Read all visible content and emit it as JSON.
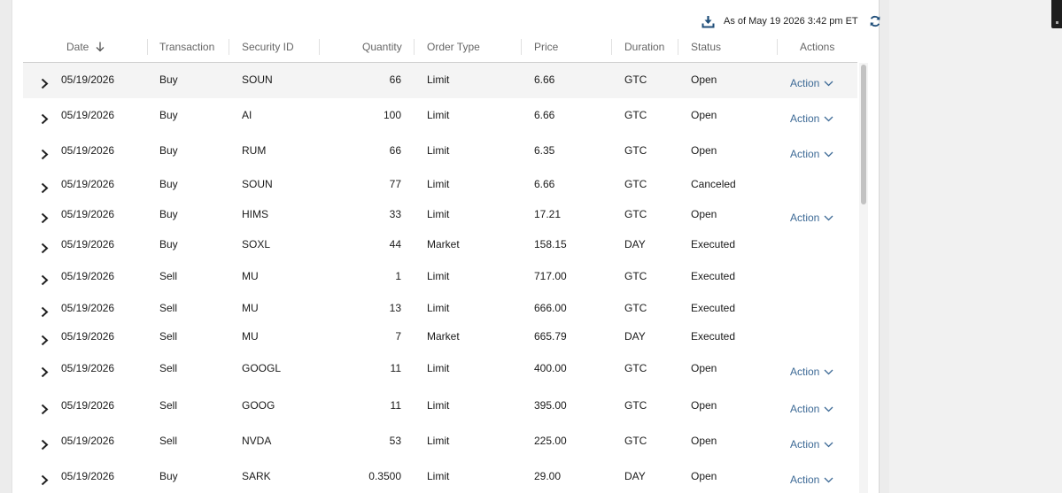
{
  "toolbar": {
    "download_icon": "download-icon",
    "as_of": "As of May 19 2026 3:42 pm ET",
    "refresh_icon": "refresh-icon"
  },
  "columns": {
    "date": "Date",
    "transaction": "Transaction",
    "security": "Security ID",
    "quantity": "Quantity",
    "order_type": "Order Type",
    "price": "Price",
    "duration": "Duration",
    "status": "Status",
    "actions": "Actions"
  },
  "sort": {
    "column": "Date",
    "direction": "descending",
    "icon": "arrow-down-icon"
  },
  "action_label": "Action",
  "colors": {
    "action_link": "#3d6a96",
    "selected_row": "#f4f4f4",
    "accent_icon": "#1f4e79"
  },
  "rows": [
    {
      "date": "05/19/2026",
      "transaction": "Buy",
      "security": "SOUN",
      "quantity": "66",
      "order_type": "Limit",
      "price": "6.66",
      "duration": "GTC",
      "status": "Open",
      "action": "Action"
    },
    {
      "date": "05/19/2026",
      "transaction": "Buy",
      "security": "AI",
      "quantity": "100",
      "order_type": "Limit",
      "price": "6.66",
      "duration": "GTC",
      "status": "Open",
      "action": "Action"
    },
    {
      "date": "05/19/2026",
      "transaction": "Buy",
      "security": "RUM",
      "quantity": "66",
      "order_type": "Limit",
      "price": "6.35",
      "duration": "GTC",
      "status": "Open",
      "action": "Action"
    },
    {
      "date": "05/19/2026",
      "transaction": "Buy",
      "security": "SOUN",
      "quantity": "77",
      "order_type": "Limit",
      "price": "6.66",
      "duration": "GTC",
      "status": "Canceled",
      "action": ""
    },
    {
      "date": "05/19/2026",
      "transaction": "Buy",
      "security": "HIMS",
      "quantity": "33",
      "order_type": "Limit",
      "price": "17.21",
      "duration": "GTC",
      "status": "Open",
      "action": "Action"
    },
    {
      "date": "05/19/2026",
      "transaction": "Buy",
      "security": "SOXL",
      "quantity": "44",
      "order_type": "Market",
      "price": "158.15",
      "duration": "DAY",
      "status": "Executed",
      "action": ""
    },
    {
      "date": "05/19/2026",
      "transaction": "Sell",
      "security": "MU",
      "quantity": "1",
      "order_type": "Limit",
      "price": "717.00",
      "duration": "GTC",
      "status": "Executed",
      "action": ""
    },
    {
      "date": "05/19/2026",
      "transaction": "Sell",
      "security": "MU",
      "quantity": "13",
      "order_type": "Limit",
      "price": "666.00",
      "duration": "GTC",
      "status": "Executed",
      "action": ""
    },
    {
      "date": "05/19/2026",
      "transaction": "Sell",
      "security": "MU",
      "quantity": "7",
      "order_type": "Market",
      "price": "665.79",
      "duration": "DAY",
      "status": "Executed",
      "action": ""
    },
    {
      "date": "05/19/2026",
      "transaction": "Sell",
      "security": "GOOGL",
      "quantity": "11",
      "order_type": "Limit",
      "price": "400.00",
      "duration": "GTC",
      "status": "Open",
      "action": "Action"
    },
    {
      "date": "05/19/2026",
      "transaction": "Sell",
      "security": "GOOG",
      "quantity": "11",
      "order_type": "Limit",
      "price": "395.00",
      "duration": "GTC",
      "status": "Open",
      "action": "Action"
    },
    {
      "date": "05/19/2026",
      "transaction": "Sell",
      "security": "NVDA",
      "quantity": "53",
      "order_type": "Limit",
      "price": "225.00",
      "duration": "GTC",
      "status": "Open",
      "action": "Action"
    },
    {
      "date": "05/19/2026",
      "transaction": "Buy",
      "security": "SARK",
      "quantity": "0.3500",
      "order_type": "Limit",
      "price": "29.00",
      "duration": "DAY",
      "status": "Open",
      "action": "Action"
    }
  ]
}
